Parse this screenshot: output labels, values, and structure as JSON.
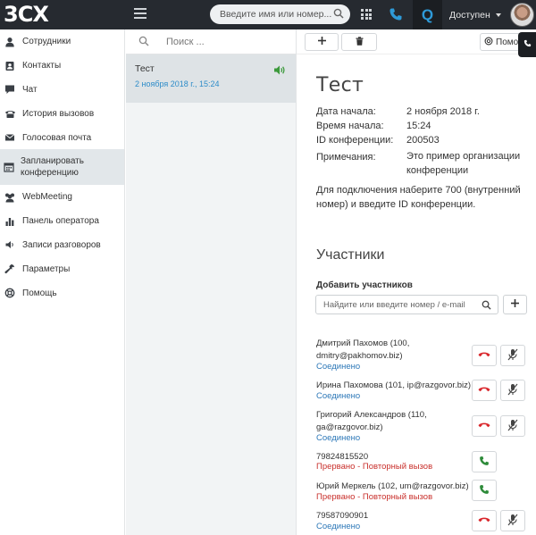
{
  "app": {
    "logo_text": "3CX"
  },
  "topbar": {
    "search_placeholder": "Введите имя или номер...",
    "q_label": "Q",
    "status_label": "Доступен"
  },
  "sidebar": {
    "items": [
      {
        "label": "Сотрудники",
        "icon": "user-icon"
      },
      {
        "label": "Контакты",
        "icon": "contacts-icon"
      },
      {
        "label": "Чат",
        "icon": "chat-icon"
      },
      {
        "label": "История вызовов",
        "icon": "phone-history-icon"
      },
      {
        "label": "Голосовая почта",
        "icon": "envelope-icon"
      },
      {
        "label": "Запланировать конференцию",
        "icon": "calendar-icon"
      },
      {
        "label": "WebMeeting",
        "icon": "users-icon"
      },
      {
        "label": "Панель оператора",
        "icon": "bar-chart-icon"
      },
      {
        "label": "Записи разговоров",
        "icon": "speaker-icon"
      },
      {
        "label": "Параметры",
        "icon": "wrench-icon"
      },
      {
        "label": "Помощь",
        "icon": "lifebuoy-icon"
      }
    ]
  },
  "list": {
    "search_placeholder": "Поиск ...",
    "items": [
      {
        "name": "Тест",
        "date": "2 ноября 2018 г., 15:24"
      }
    ]
  },
  "toolbar": {
    "add_label": "+",
    "help_label": "Помо"
  },
  "conference": {
    "title": "Тест",
    "fields": [
      {
        "key": "Дата начала:",
        "value": "2 ноября 2018 г."
      },
      {
        "key": "Время начала:",
        "value": "15:24"
      },
      {
        "key": "ID конференции:",
        "value": "200503"
      }
    ],
    "notes_key": "Примечания:",
    "notes_value": "Это пример организации конференции",
    "hint": "Для подключения наберите 700 (внутренний номер) и введите ID конференции."
  },
  "participants": {
    "heading": "Участники",
    "add_label": "Добавить участников",
    "add_placeholder": "Найдите или введите номер / e-mail",
    "items": [
      {
        "name": "Дмитрий Пахомов (100, dmitry@pakhomov.biz)",
        "status": "Соединено",
        "state": "connected"
      },
      {
        "name": "Ирина Пахомова (101, ip@razgovor.biz)",
        "status": "Соединено",
        "state": "connected"
      },
      {
        "name": "Григорий Александров (110, ga@razgovor.biz)",
        "status": "Соединено",
        "state": "connected"
      },
      {
        "name": "79824815520",
        "status": "Прервано - Повторный вызов",
        "state": "dropped"
      },
      {
        "name": "Юрий Меркель (102, um@razgovor.biz)",
        "status": "Прервано - Повторный вызов",
        "state": "dropped"
      },
      {
        "name": "79587090901",
        "status": "Соединено",
        "state": "connected"
      }
    ]
  },
  "colors": {
    "topbar": "#262a30",
    "accent_blue": "#2d8cc9",
    "connected": "#2d78b8",
    "dropped": "#c9302c",
    "hangup_red": "#d9262b",
    "call_green": "#2e8b3a"
  }
}
